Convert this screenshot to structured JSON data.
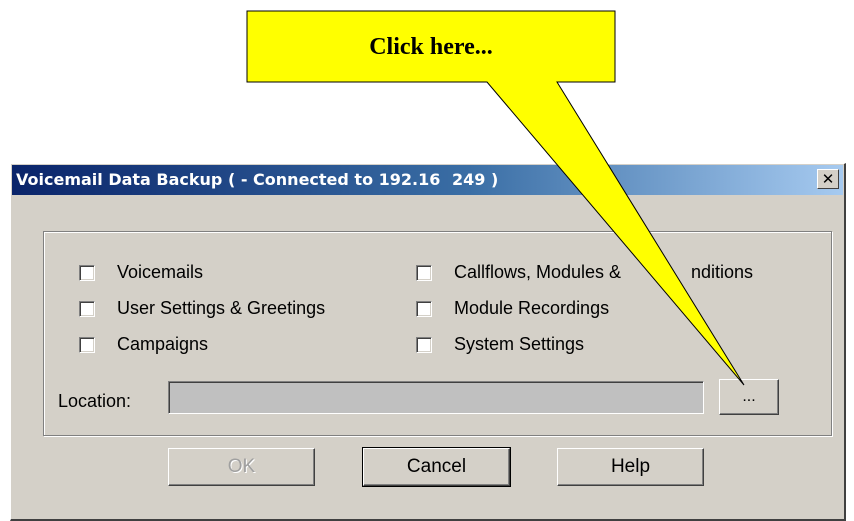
{
  "callout": {
    "text": "Click here...",
    "fill_color": "#ffff00"
  },
  "dialog": {
    "title": "Voicemail Data Backup (  - Connected to 192.16",
    "title_end": "249 )",
    "close_glyph": "✕",
    "checkboxes": [
      {
        "label": "Voicemails",
        "checked": false
      },
      {
        "label": "User Settings & Greetings",
        "checked": false
      },
      {
        "label": "Campaigns",
        "checked": false
      },
      {
        "label": "Callflows, Modules &",
        "label_end": "nditions",
        "checked": false
      },
      {
        "label": "Module Recordings",
        "checked": false
      },
      {
        "label": "System Settings",
        "checked": false
      }
    ],
    "location_label": "Location:",
    "location_value": "",
    "browse_label": "...",
    "buttons": {
      "ok": "OK",
      "cancel": "Cancel",
      "help": "Help"
    },
    "colors": {
      "titlebar_start": "#0a246a",
      "face": "#d4d0c8"
    }
  }
}
